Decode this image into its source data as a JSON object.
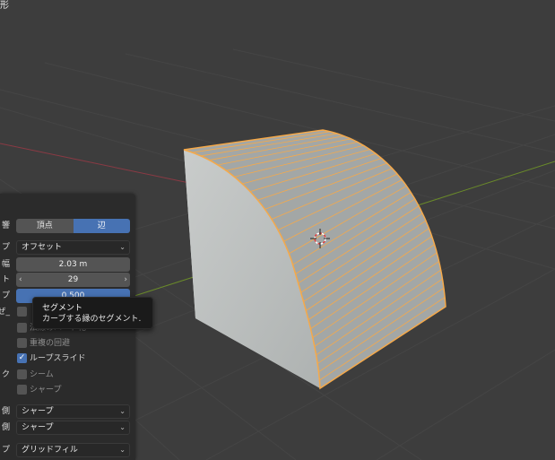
{
  "window_title": "形",
  "panel": {
    "affect_label": "響",
    "affect_options": [
      "頂点",
      "辺"
    ],
    "width_type_label": "プ",
    "width_type_value": "オフセット",
    "width_label": "幅",
    "width_value": "2.03 m",
    "segments_label": "ト",
    "segments_value": "29",
    "profile_label": "プ",
    "profile_value": "0.500",
    "clamp_label": "ぜ_",
    "harden_normals": "法線のハード化",
    "mark_seam_row_label": "ク",
    "reverse_overlap": "重複の回避",
    "loop_slide": "ループスライド",
    "seam": "シーム",
    "sharp": "シャープ",
    "outer_miter_label": "側",
    "outer_miter_value": "シャープ",
    "inner_miter_label": "側",
    "inner_miter_value": "シャープ",
    "fill_type_label": "プ",
    "fill_type_value": "グリッドフィル"
  },
  "tooltip": {
    "title": "セグメント",
    "description": "カーブする縁のセグメント."
  },
  "colors": {
    "accent": "#4772b3",
    "selection_edge": "#f5a94a",
    "viewport_bg": "#3d3d3d",
    "x_axis": "#8a3a44",
    "y_axis": "#6a8a2a"
  }
}
